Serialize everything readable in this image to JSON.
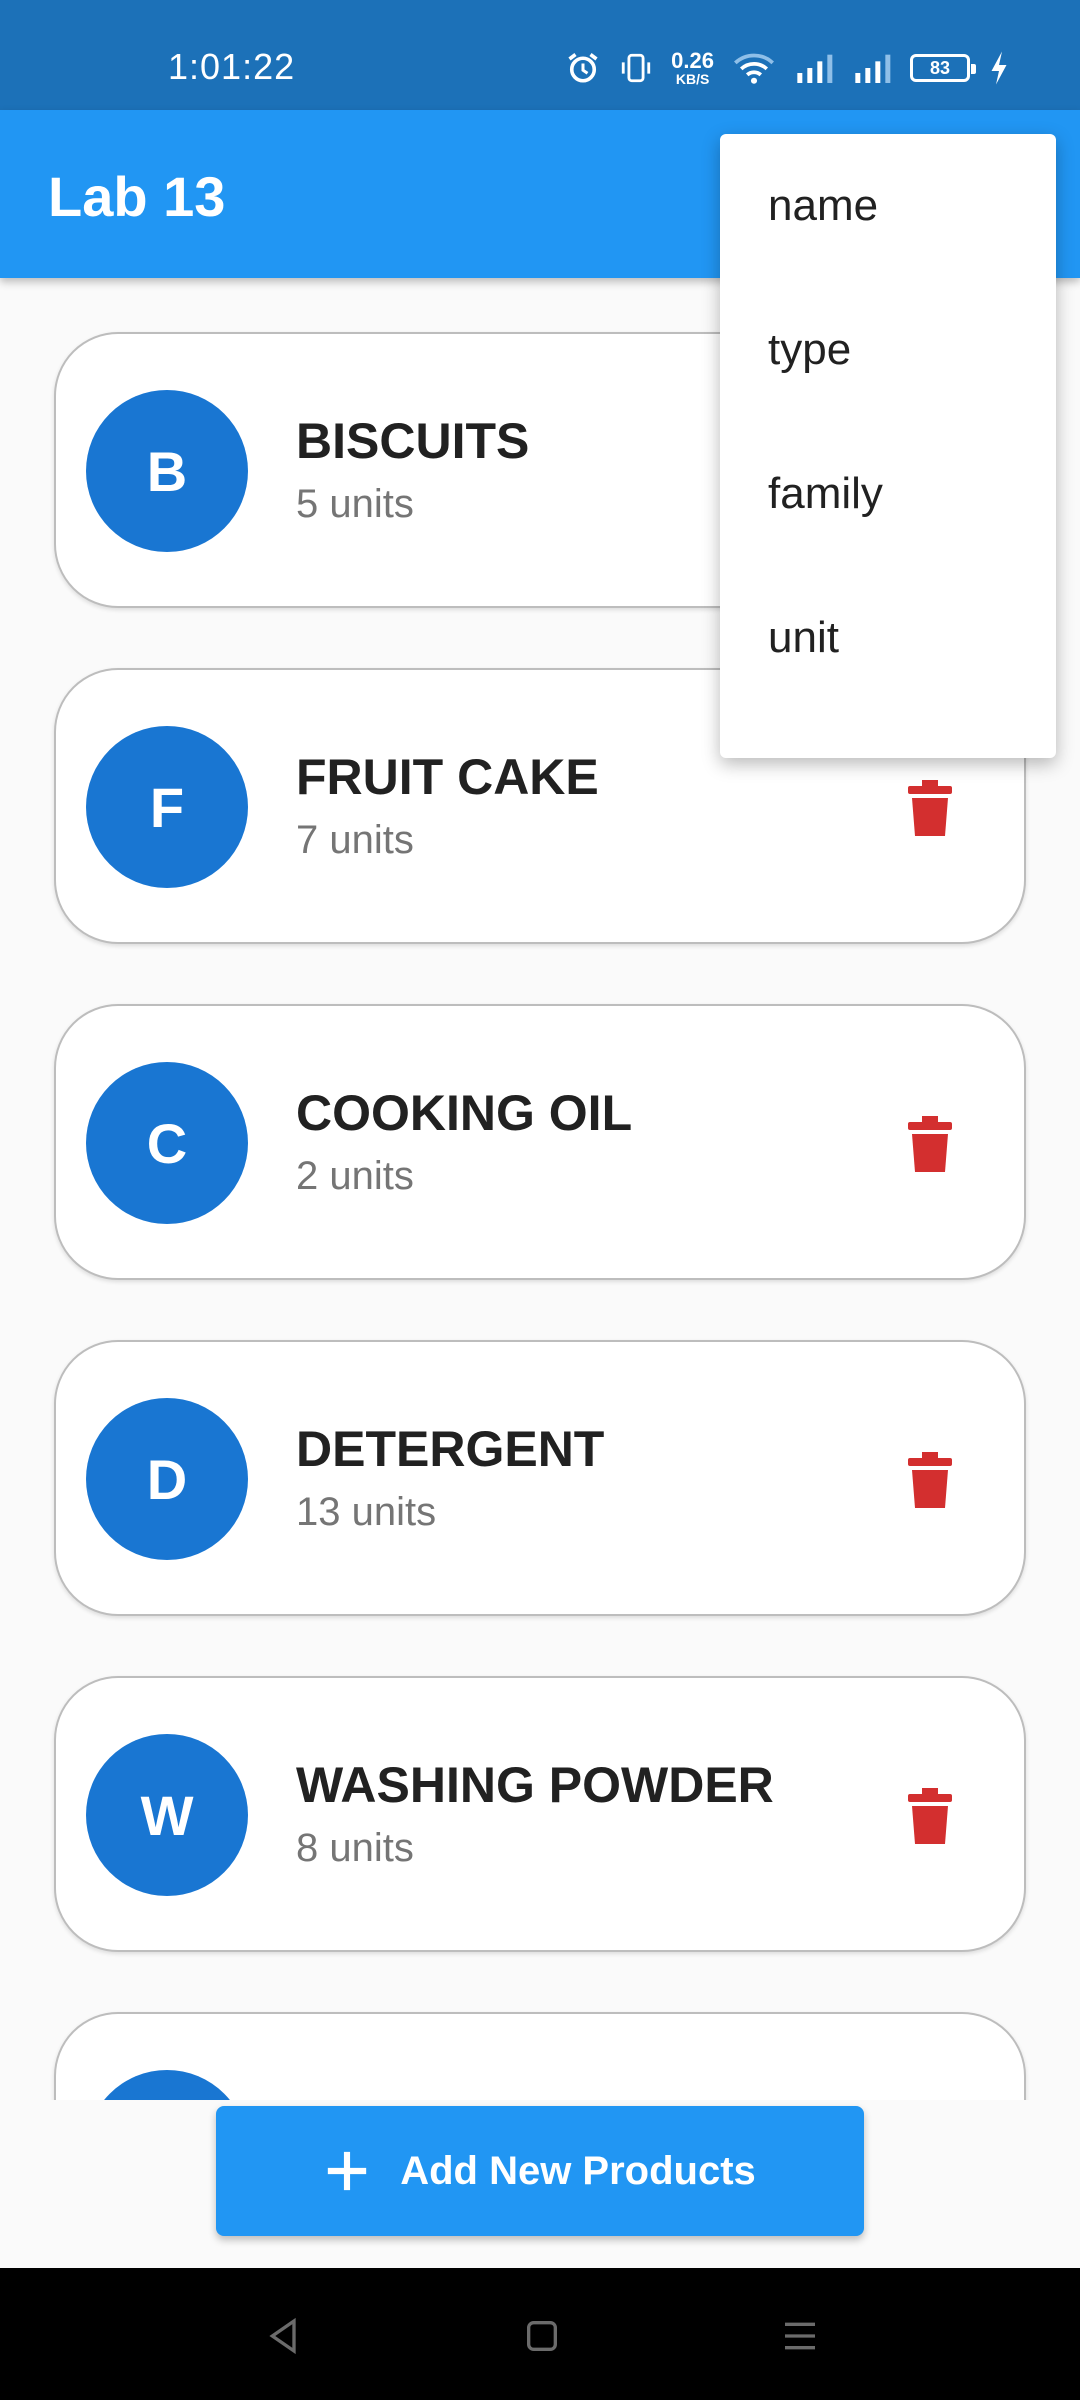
{
  "status_bar": {
    "time": "1:01:22",
    "net_speed_value": "0.26",
    "net_speed_unit": "KB/S",
    "battery_level": "83",
    "icons": [
      "alarm-icon",
      "vibrate-icon",
      "wifi-icon",
      "signal-icon",
      "signal-icon",
      "battery-icon",
      "charging-icon"
    ]
  },
  "app_bar": {
    "title": "Lab 13"
  },
  "menu": {
    "items": [
      "name",
      "type",
      "family",
      "unit"
    ]
  },
  "products": [
    {
      "initial": "B",
      "name": "BISCUITS",
      "units": "5 units"
    },
    {
      "initial": "F",
      "name": "FRUIT CAKE",
      "units": "7 units"
    },
    {
      "initial": "C",
      "name": "COOKING OIL",
      "units": "2 units"
    },
    {
      "initial": "D",
      "name": "DETERGENT",
      "units": "13 units"
    },
    {
      "initial": "W",
      "name": "WASHING POWDER",
      "units": "8 units"
    }
  ],
  "add_button": {
    "label": "Add New Products",
    "icon": "plus-icon"
  },
  "nav_bar": {
    "buttons": [
      "back-icon",
      "home-icon",
      "menu-icon"
    ]
  },
  "colors": {
    "status_bar": "#1c71b8",
    "app_bar": "#2196f3",
    "avatar": "#1976d2",
    "delete": "#d32f2f",
    "button": "#2196f3"
  }
}
